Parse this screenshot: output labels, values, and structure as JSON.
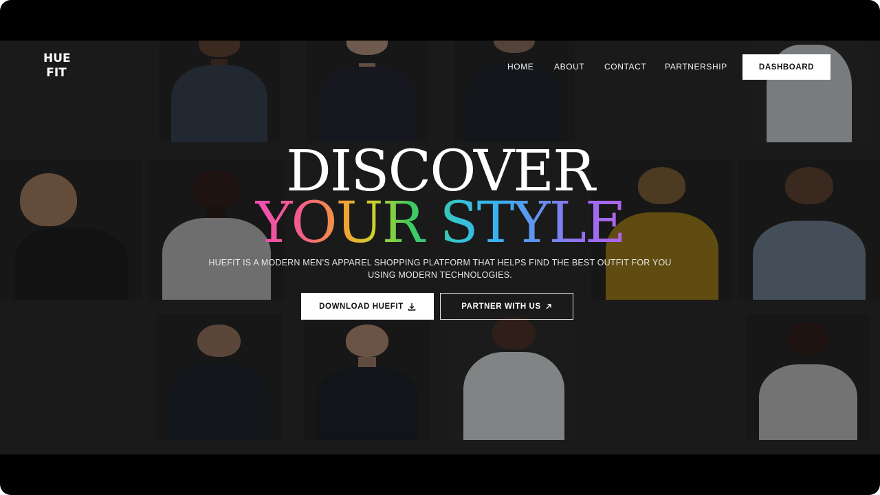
{
  "brand": {
    "logo_line1": "HUE",
    "logo_line2": "FIT"
  },
  "nav": {
    "items": [
      {
        "label": "HOME"
      },
      {
        "label": "ABOUT"
      },
      {
        "label": "CONTACT"
      },
      {
        "label": "PARTNERSHIP"
      }
    ],
    "dashboard_label": "DASHBOARD"
  },
  "hero": {
    "title_line1": "DISCOVER",
    "title_line2": "YOUR STYLE",
    "description": "HUEFIT IS A MODERN MEN'S APPAREL SHOPPING PLATFORM THAT HELPS FIND THE BEST OUTFIT FOR YOU USING MODERN TECHNOLOGIES.",
    "download_label": "DOWNLOAD HUEFIT",
    "download_icon": "download-icon",
    "partner_label": "PARTNER WITH US",
    "partner_icon": "arrow-up-right-icon"
  },
  "colors": {
    "background": "#1a1a1a",
    "frame": "#000000",
    "gradient": [
      "#f04fb3",
      "#f2a032",
      "#3fca5a",
      "#35c3d6",
      "#6b8cf0",
      "#b263ec"
    ]
  }
}
